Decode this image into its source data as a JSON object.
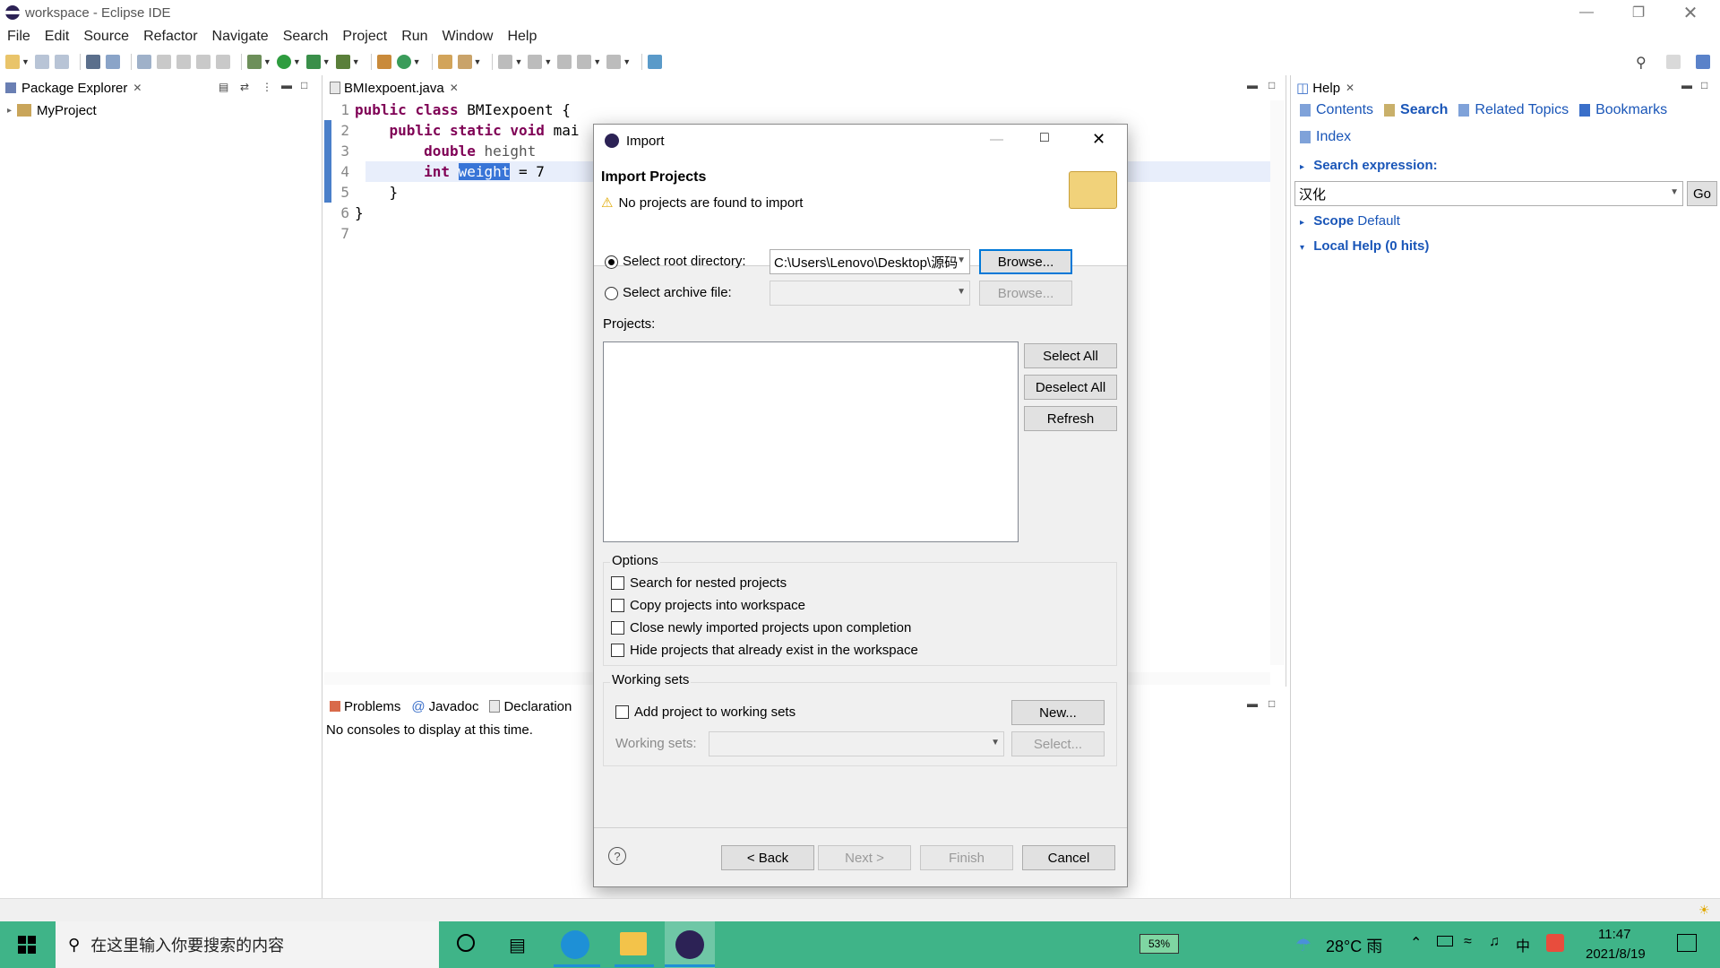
{
  "window": {
    "title": "workspace - Eclipse IDE"
  },
  "menubar": [
    "File",
    "Edit",
    "Source",
    "Refactor",
    "Navigate",
    "Search",
    "Project",
    "Run",
    "Window",
    "Help"
  ],
  "package_explorer": {
    "tab": "Package Explorer",
    "items": [
      {
        "label": "MyProject"
      }
    ]
  },
  "editor": {
    "tab": "BMIexpoent.java",
    "lines": [
      {
        "n": "1",
        "code": "public class BMIexpoent {"
      },
      {
        "n": "2",
        "code": "    public static void mai"
      },
      {
        "n": "3",
        "code": "        double height"
      },
      {
        "n": "4",
        "code": "        int weight = 7"
      },
      {
        "n": "5",
        "code": "    }"
      },
      {
        "n": "6",
        "code": "}"
      },
      {
        "n": "7",
        "code": ""
      }
    ]
  },
  "console": {
    "tabs": [
      "Problems",
      "Javadoc",
      "Declaration"
    ],
    "message": "No consoles to display at this time."
  },
  "help": {
    "tab": "Help",
    "links": [
      "Contents",
      "Search",
      "Related Topics",
      "Bookmarks",
      "Index"
    ],
    "search_expression_label": "Search expression:",
    "search_value": "汉化",
    "go_label": "Go",
    "scope_label": "Scope",
    "scope_value": "Default",
    "local_help": "Local Help (0 hits)"
  },
  "dialog": {
    "title": "Import",
    "heading": "Import Projects",
    "warning": "No projects are found to import",
    "select_root_label": "Select root directory:",
    "root_value": "C:\\Users\\Lenovo\\Desktop\\源码",
    "browse_label": "Browse...",
    "select_archive_label": "Select archive file:",
    "projects_label": "Projects:",
    "select_all": "Select All",
    "deselect_all": "Deselect All",
    "refresh": "Refresh",
    "options_label": "Options",
    "options": [
      "Search for nested projects",
      "Copy projects into workspace",
      "Close newly imported projects upon completion",
      "Hide projects that already exist in the workspace"
    ],
    "working_sets_label": "Working sets",
    "add_to_ws": "Add project to working sets",
    "new_label": "New...",
    "working_sets_field": "Working sets:",
    "select_label": "Select...",
    "back": "< Back",
    "next": "Next >",
    "finish": "Finish",
    "cancel": "Cancel"
  },
  "taskbar": {
    "search_placeholder": "在这里输入你要搜索的内容",
    "battery": "53%",
    "weather": "28°C 雨",
    "time": "11:47",
    "date": "2021/8/19",
    "ime": "中"
  }
}
